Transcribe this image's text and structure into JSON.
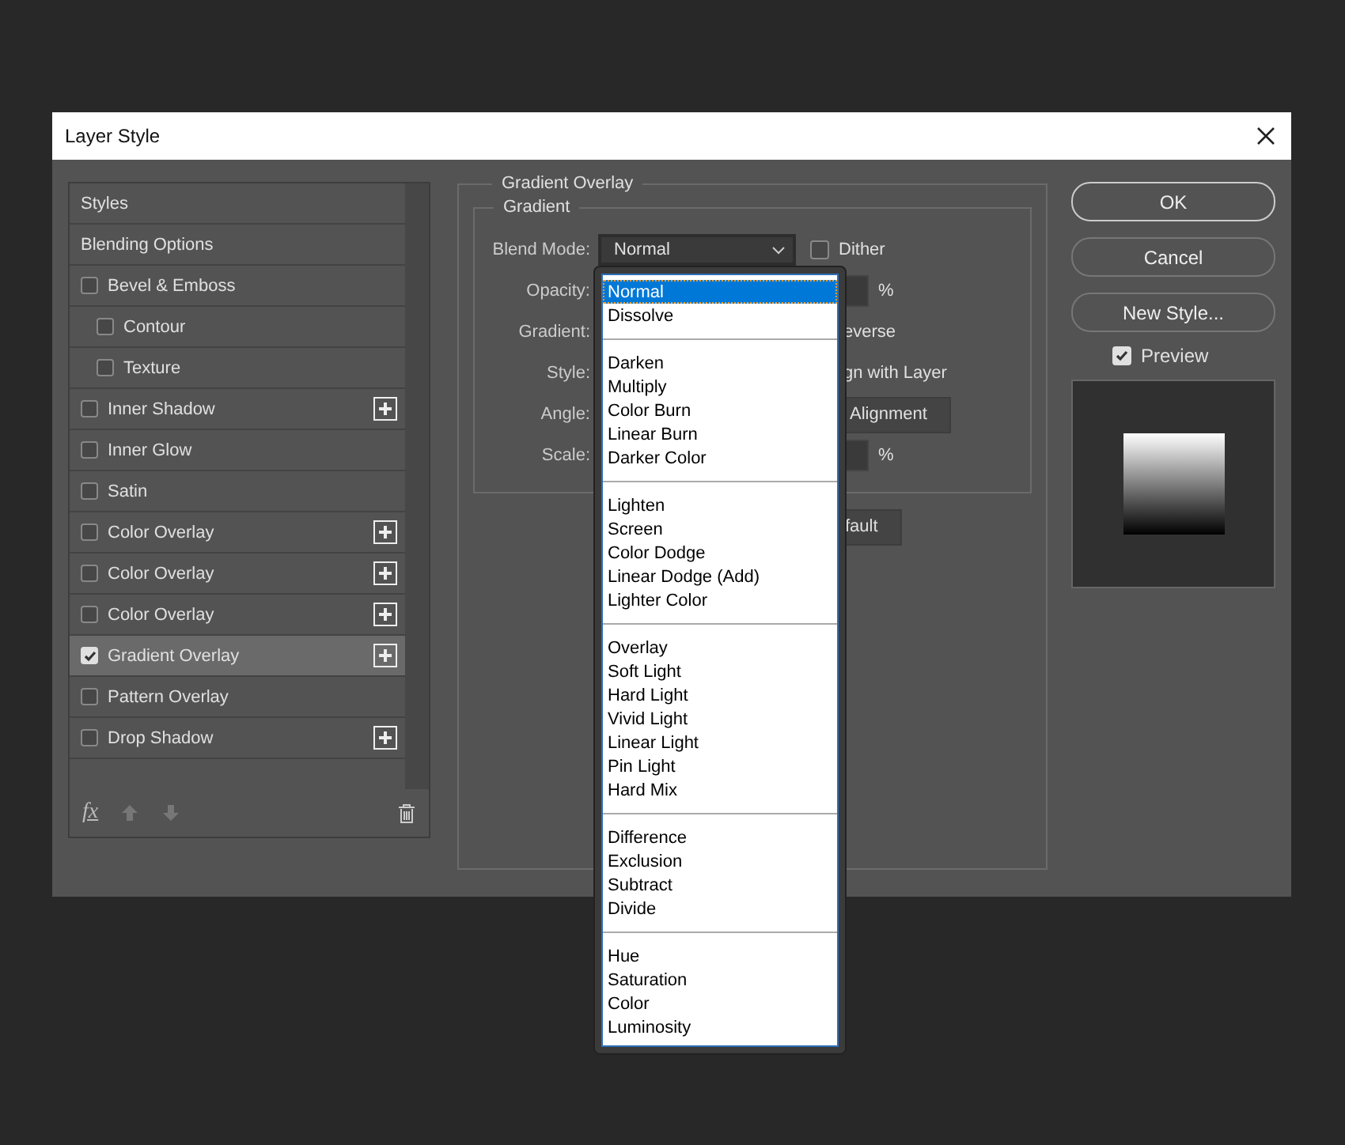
{
  "window": {
    "title": "Layer Style"
  },
  "styles_list": {
    "items": [
      {
        "label": "Styles",
        "kind": "header",
        "selected": false
      },
      {
        "label": "Blending Options",
        "kind": "header",
        "selected": false
      },
      {
        "label": "Bevel & Emboss",
        "kind": "effect",
        "checked": false,
        "selected": false,
        "add_button": false,
        "children": [
          {
            "label": "Contour",
            "kind": "effect",
            "checked": false,
            "selected": false,
            "add_button": false
          },
          {
            "label": "Texture",
            "kind": "effect",
            "checked": false,
            "selected": false,
            "add_button": false
          }
        ]
      },
      {
        "label": "Inner Shadow",
        "kind": "effect",
        "checked": false,
        "selected": false,
        "add_button": true
      },
      {
        "label": "Inner Glow",
        "kind": "effect",
        "checked": false,
        "selected": false,
        "add_button": false
      },
      {
        "label": "Satin",
        "kind": "effect",
        "checked": false,
        "selected": false,
        "add_button": false
      },
      {
        "label": "Color Overlay",
        "kind": "effect",
        "checked": false,
        "selected": false,
        "add_button": true
      },
      {
        "label": "Color Overlay",
        "kind": "effect",
        "checked": false,
        "selected": false,
        "add_button": true
      },
      {
        "label": "Color Overlay",
        "kind": "effect",
        "checked": false,
        "selected": false,
        "add_button": true
      },
      {
        "label": "Gradient Overlay",
        "kind": "effect",
        "checked": true,
        "selected": true,
        "add_button": true
      },
      {
        "label": "Pattern Overlay",
        "kind": "effect",
        "checked": false,
        "selected": false,
        "add_button": false
      },
      {
        "label": "Drop Shadow",
        "kind": "effect",
        "checked": false,
        "selected": false,
        "add_button": true
      }
    ],
    "footer": {
      "fx": "fx"
    }
  },
  "panel": {
    "title": "Gradient Overlay",
    "group_title": "Gradient",
    "rows": [
      {
        "label": "Blend Mode:",
        "kind": "select",
        "value": "Normal",
        "checkbox": {
          "label": "Dither",
          "checked": false
        }
      },
      {
        "label": "Opacity:",
        "kind": "number",
        "unit": "%"
      },
      {
        "label": "Gradient:",
        "kind": "text",
        "text": "everse"
      },
      {
        "label": "Style:",
        "kind": "text",
        "text": "gn with Layer"
      },
      {
        "label": "Angle:",
        "kind": "button",
        "button": "Alignment"
      },
      {
        "label": "Scale:",
        "kind": "number",
        "unit": "%"
      }
    ],
    "bottom_button": "fault"
  },
  "blend_menu": {
    "groups": [
      [
        {
          "label": "Normal",
          "selected": true
        },
        {
          "label": "Dissolve",
          "selected": false
        }
      ],
      [
        {
          "label": "Darken",
          "selected": false
        },
        {
          "label": "Multiply",
          "selected": false
        },
        {
          "label": "Color Burn",
          "selected": false
        },
        {
          "label": "Linear Burn",
          "selected": false
        },
        {
          "label": "Darker Color",
          "selected": false
        }
      ],
      [
        {
          "label": "Lighten",
          "selected": false
        },
        {
          "label": "Screen",
          "selected": false
        },
        {
          "label": "Color Dodge",
          "selected": false
        },
        {
          "label": "Linear Dodge (Add)",
          "selected": false
        },
        {
          "label": "Lighter Color",
          "selected": false
        }
      ],
      [
        {
          "label": "Overlay",
          "selected": false
        },
        {
          "label": "Soft Light",
          "selected": false
        },
        {
          "label": "Hard Light",
          "selected": false
        },
        {
          "label": "Vivid Light",
          "selected": false
        },
        {
          "label": "Linear Light",
          "selected": false
        },
        {
          "label": "Pin Light",
          "selected": false
        },
        {
          "label": "Hard Mix",
          "selected": false
        }
      ],
      [
        {
          "label": "Difference",
          "selected": false
        },
        {
          "label": "Exclusion",
          "selected": false
        },
        {
          "label": "Subtract",
          "selected": false
        },
        {
          "label": "Divide",
          "selected": false
        }
      ],
      [
        {
          "label": "Hue",
          "selected": false
        },
        {
          "label": "Saturation",
          "selected": false
        },
        {
          "label": "Color",
          "selected": false
        },
        {
          "label": "Luminosity",
          "selected": false
        }
      ]
    ]
  },
  "buttons": [
    {
      "label": "OK",
      "default": true
    },
    {
      "label": "Cancel",
      "default": false
    },
    {
      "label": "New Style...",
      "default": false
    }
  ],
  "preview": {
    "label": "Preview",
    "checked": true
  }
}
